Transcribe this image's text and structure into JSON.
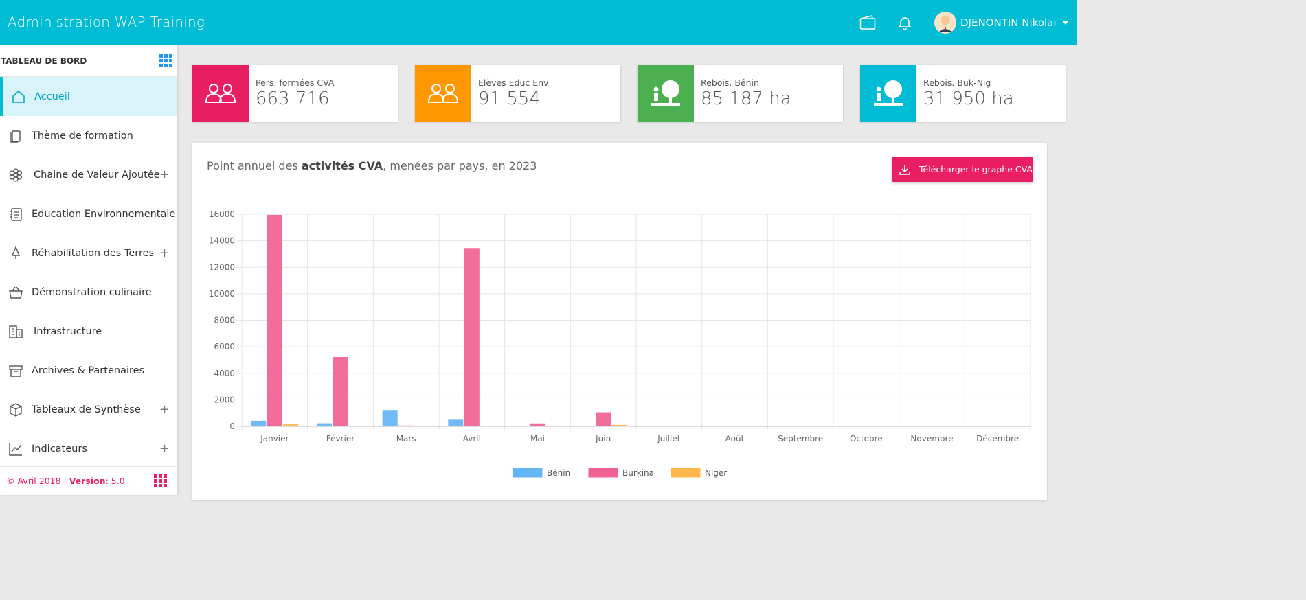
{
  "header": {
    "title": "Administration WAP Training",
    "user_name": "DJENONTIN Nikolai",
    "icons": [
      "wallet-icon",
      "bell-icon",
      "avatar",
      "caret-down-icon"
    ],
    "color": "#00bcd4"
  },
  "sidebar": {
    "title": "TABLEAU DE BORD",
    "items": [
      {
        "label": "Accueil",
        "icon": "home-icon",
        "active": true,
        "expandable": false
      },
      {
        "label": "Thème de formation",
        "icon": "copy-icon",
        "active": false,
        "expandable": false
      },
      {
        "label": "Chaine de Valeur Ajoutée",
        "icon": "flower-icon",
        "active": false,
        "expandable": true
      },
      {
        "label": "Education Environnementale",
        "icon": "notes-icon",
        "active": false,
        "expandable": false
      },
      {
        "label": "Réhabilitation des Terres",
        "icon": "tree-icon",
        "active": false,
        "expandable": true
      },
      {
        "label": "Démonstration culinaire",
        "icon": "basket-icon",
        "active": false,
        "expandable": false
      },
      {
        "label": "Infrastructure",
        "icon": "building-icon",
        "active": false,
        "expandable": false
      },
      {
        "label": "Archives & Partenaires",
        "icon": "archive-icon",
        "active": false,
        "expandable": false
      },
      {
        "label": "Tableaux de Synthèse",
        "icon": "cube-icon",
        "active": false,
        "expandable": true
      },
      {
        "label": "Indicateurs",
        "icon": "trend-chart-icon",
        "active": false,
        "expandable": true
      }
    ],
    "plus": "+",
    "footer": {
      "copyright": "© Avril 2018 | ",
      "version_label": "Version",
      "version_value": ": 5.0"
    }
  },
  "cards": [
    {
      "label": "Pers. formées CVA",
      "value": "663 716",
      "color": "#e91e63",
      "icon": "people-icon"
    },
    {
      "label": "Elèves Educ Env",
      "value": "91 554",
      "color": "#ff9800",
      "icon": "people-icon"
    },
    {
      "label": "Rebois. Bénin",
      "value": "85 187 ha",
      "color": "#4caf50",
      "icon": "person-tree-icon"
    },
    {
      "label": "Rebois. Buk-Nig",
      "value": "31 950 ha",
      "color": "#00bcd4",
      "icon": "person-tree-icon"
    }
  ],
  "panel": {
    "title_prefix": "Point annuel des ",
    "title_bold": "activités CVA",
    "title_suffix": ", menées par pays, en 2023",
    "download_label": "Télécharger le graphe CVA",
    "download_color": "#e91e63"
  },
  "chart_data": {
    "type": "bar",
    "title": "",
    "xlabel": "",
    "ylabel": "",
    "ylim": [
      0,
      16000
    ],
    "yticks": [
      0,
      2000,
      4000,
      6000,
      8000,
      10000,
      12000,
      14000,
      16000
    ],
    "categories": [
      "Janvier",
      "Février",
      "Mars",
      "Avril",
      "Mai",
      "Juin",
      "Juillet",
      "Août",
      "Septembre",
      "Octobre",
      "Novembre",
      "Décembre"
    ],
    "series": [
      {
        "name": "Bénin",
        "color": "#64b5f6",
        "values": [
          420,
          230,
          1230,
          500,
          20,
          0,
          0,
          0,
          0,
          0,
          0,
          0
        ]
      },
      {
        "name": "Burkina",
        "color": "#f06292",
        "values": [
          15950,
          5230,
          60,
          13450,
          220,
          1060,
          0,
          0,
          0,
          0,
          0,
          0
        ]
      },
      {
        "name": "Niger",
        "color": "#ffb74d",
        "values": [
          170,
          0,
          0,
          0,
          0,
          110,
          0,
          0,
          0,
          0,
          0,
          0
        ]
      }
    ],
    "grid": true,
    "legend": "bottom"
  }
}
